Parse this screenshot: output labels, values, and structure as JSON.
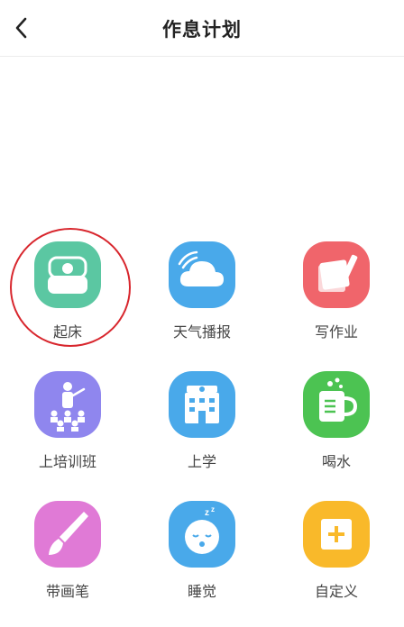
{
  "header": {
    "title": "作息计划"
  },
  "items": [
    {
      "label": "起床",
      "icon": "bed-icon",
      "color": "#5bc7a2"
    },
    {
      "label": "天气播报",
      "icon": "cloud-icon",
      "color": "#49a9ea"
    },
    {
      "label": "写作业",
      "icon": "notebook-pen-icon",
      "color": "#f0656b"
    },
    {
      "label": "上培训班",
      "icon": "teacher-class-icon",
      "color": "#8f86ee"
    },
    {
      "label": "上学",
      "icon": "school-icon",
      "color": "#49a9ea"
    },
    {
      "label": "喝水",
      "icon": "cup-icon",
      "color": "#4cc352"
    },
    {
      "label": "带画笔",
      "icon": "paintbrush-icon",
      "color": "#e07ad6"
    },
    {
      "label": "睡觉",
      "icon": "sleeping-baby-icon",
      "color": "#49a9ea"
    },
    {
      "label": "自定义",
      "icon": "add-square-icon",
      "color": "#f9b92a"
    }
  ],
  "highlight": {
    "target": "起床",
    "color": "#d8262d"
  }
}
